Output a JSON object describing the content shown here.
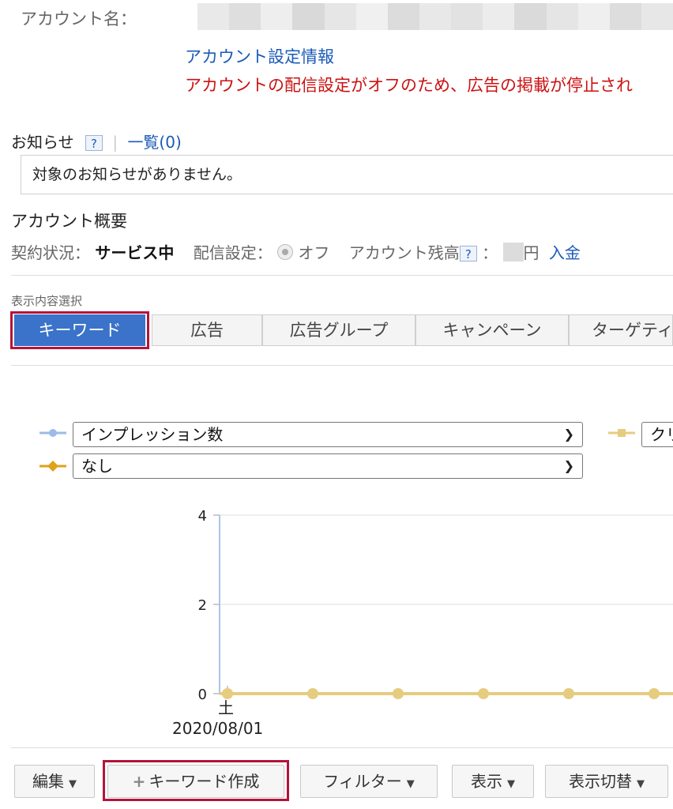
{
  "account": {
    "name_label": "アカウント名：",
    "settings_link": "アカウント設定情報",
    "delivery_warning": "アカウントの配信設定がオフのため、広告の掲載が停止され"
  },
  "notice": {
    "title": "お知らせ",
    "help": "?",
    "list_link": "一覧(0)",
    "message": "対象のお知らせがありません。"
  },
  "overview": {
    "title": "アカウント概要",
    "contract_label": "契約状況：",
    "contract_value": "サービス中",
    "delivery_label": "配信設定：",
    "delivery_value": "オフ",
    "balance_label": "アカウント残高",
    "balance_help": "?",
    "balance_colon": "：",
    "balance_unit": "円",
    "deposit_link": "入金"
  },
  "view_select": {
    "label": "表示内容選択",
    "tabs": [
      "キーワード",
      "広告",
      "広告グループ",
      "キャンペーン",
      "ターゲティ"
    ]
  },
  "chart_controls": {
    "metric1": "インプレッション数",
    "metric2": "なし",
    "metric3": "クリ",
    "metric1_color": "#9dbbe6",
    "metric2_color": "#e0a11b",
    "metric3_color": "#e6cc7f"
  },
  "chart_data": {
    "type": "line",
    "y_ticks": [
      "4",
      "2",
      "0"
    ],
    "ylim": [
      0,
      4
    ],
    "x_label_day": "土",
    "x_label_date": "2020/08/01",
    "series": [
      {
        "values": [
          0,
          0,
          0,
          0,
          0,
          0,
          0
        ],
        "color": "#e6cc7f"
      }
    ],
    "grid": true
  },
  "toolbar": {
    "edit": "編集",
    "create_keyword": "キーワード作成",
    "filter": "フィルター",
    "display": "表示",
    "display_switch": "表示切替"
  }
}
